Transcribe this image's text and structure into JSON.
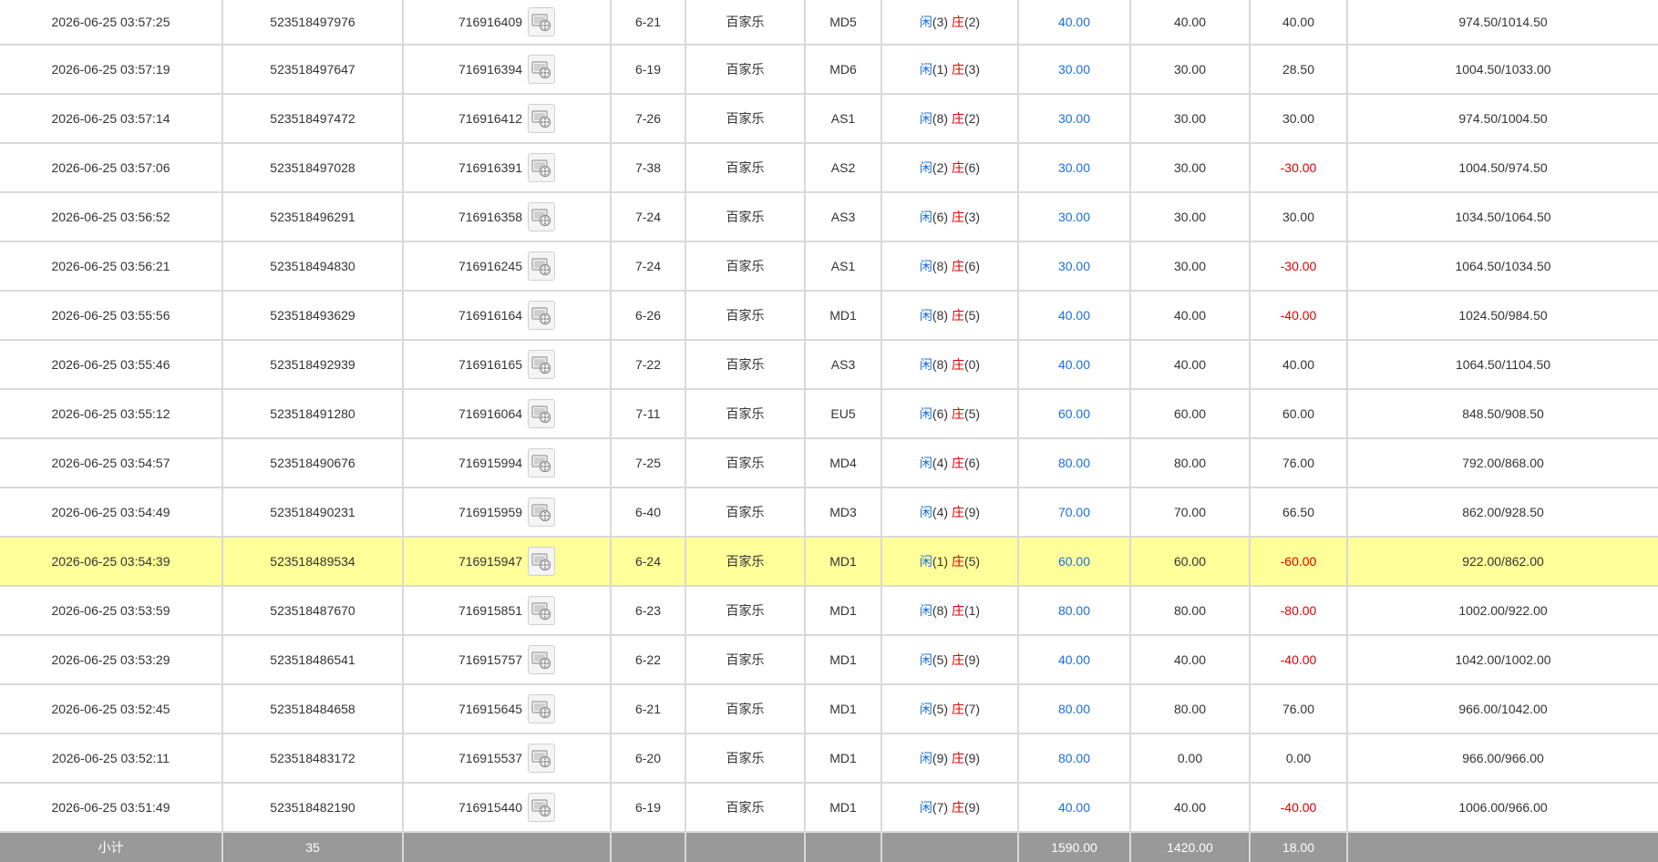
{
  "table": {
    "rows": [
      {
        "time": "2026-06-25 03:57:25",
        "bet_id": "523518497976",
        "round_id": "716916409",
        "shoe": "6-21",
        "game": "百家乐",
        "table": "MD5",
        "player_label": "闲",
        "player_score": "(3)",
        "banker_label": "庄",
        "banker_score": "(2)",
        "bet_amount": "40.00",
        "valid_bet": "40.00",
        "win_loss": "40.00",
        "win_loss_negative": false,
        "balance": "974.50/1014.50",
        "highlight": false
      },
      {
        "time": "2026-06-25 03:57:19",
        "bet_id": "523518497647",
        "round_id": "716916394",
        "shoe": "6-19",
        "game": "百家乐",
        "table": "MD6",
        "player_label": "闲",
        "player_score": "(1)",
        "banker_label": "庄",
        "banker_score": "(3)",
        "bet_amount": "30.00",
        "valid_bet": "30.00",
        "win_loss": "28.50",
        "win_loss_negative": false,
        "balance": "1004.50/1033.00",
        "highlight": false
      },
      {
        "time": "2026-06-25 03:57:14",
        "bet_id": "523518497472",
        "round_id": "716916412",
        "shoe": "7-26",
        "game": "百家乐",
        "table": "AS1",
        "player_label": "闲",
        "player_score": "(8)",
        "banker_label": "庄",
        "banker_score": "(2)",
        "bet_amount": "30.00",
        "valid_bet": "30.00",
        "win_loss": "30.00",
        "win_loss_negative": false,
        "balance": "974.50/1004.50",
        "highlight": false
      },
      {
        "time": "2026-06-25 03:57:06",
        "bet_id": "523518497028",
        "round_id": "716916391",
        "shoe": "7-38",
        "game": "百家乐",
        "table": "AS2",
        "player_label": "闲",
        "player_score": "(2)",
        "banker_label": "庄",
        "banker_score": "(6)",
        "bet_amount": "30.00",
        "valid_bet": "30.00",
        "win_loss": "-30.00",
        "win_loss_negative": true,
        "balance": "1004.50/974.50",
        "highlight": false
      },
      {
        "time": "2026-06-25 03:56:52",
        "bet_id": "523518496291",
        "round_id": "716916358",
        "shoe": "7-24",
        "game": "百家乐",
        "table": "AS3",
        "player_label": "闲",
        "player_score": "(6)",
        "banker_label": "庄",
        "banker_score": "(3)",
        "bet_amount": "30.00",
        "valid_bet": "30.00",
        "win_loss": "30.00",
        "win_loss_negative": false,
        "balance": "1034.50/1064.50",
        "highlight": false
      },
      {
        "time": "2026-06-25 03:56:21",
        "bet_id": "523518494830",
        "round_id": "716916245",
        "shoe": "7-24",
        "game": "百家乐",
        "table": "AS1",
        "player_label": "闲",
        "player_score": "(8)",
        "banker_label": "庄",
        "banker_score": "(6)",
        "bet_amount": "30.00",
        "valid_bet": "30.00",
        "win_loss": "-30.00",
        "win_loss_negative": true,
        "balance": "1064.50/1034.50",
        "highlight": false
      },
      {
        "time": "2026-06-25 03:55:56",
        "bet_id": "523518493629",
        "round_id": "716916164",
        "shoe": "6-26",
        "game": "百家乐",
        "table": "MD1",
        "player_label": "闲",
        "player_score": "(8)",
        "banker_label": "庄",
        "banker_score": "(5)",
        "bet_amount": "40.00",
        "valid_bet": "40.00",
        "win_loss": "-40.00",
        "win_loss_negative": true,
        "balance": "1024.50/984.50",
        "highlight": false
      },
      {
        "time": "2026-06-25 03:55:46",
        "bet_id": "523518492939",
        "round_id": "716916165",
        "shoe": "7-22",
        "game": "百家乐",
        "table": "AS3",
        "player_label": "闲",
        "player_score": "(8)",
        "banker_label": "庄",
        "banker_score": "(0)",
        "bet_amount": "40.00",
        "valid_bet": "40.00",
        "win_loss": "40.00",
        "win_loss_negative": false,
        "balance": "1064.50/1104.50",
        "highlight": false
      },
      {
        "time": "2026-06-25 03:55:12",
        "bet_id": "523518491280",
        "round_id": "716916064",
        "shoe": "7-11",
        "game": "百家乐",
        "table": "EU5",
        "player_label": "闲",
        "player_score": "(6)",
        "banker_label": "庄",
        "banker_score": "(5)",
        "bet_amount": "60.00",
        "valid_bet": "60.00",
        "win_loss": "60.00",
        "win_loss_negative": false,
        "balance": "848.50/908.50",
        "highlight": false
      },
      {
        "time": "2026-06-25 03:54:57",
        "bet_id": "523518490676",
        "round_id": "716915994",
        "shoe": "7-25",
        "game": "百家乐",
        "table": "MD4",
        "player_label": "闲",
        "player_score": "(4)",
        "banker_label": "庄",
        "banker_score": "(6)",
        "bet_amount": "80.00",
        "valid_bet": "80.00",
        "win_loss": "76.00",
        "win_loss_negative": false,
        "balance": "792.00/868.00",
        "highlight": false
      },
      {
        "time": "2026-06-25 03:54:49",
        "bet_id": "523518490231",
        "round_id": "716915959",
        "shoe": "6-40",
        "game": "百家乐",
        "table": "MD3",
        "player_label": "闲",
        "player_score": "(4)",
        "banker_label": "庄",
        "banker_score": "(9)",
        "bet_amount": "70.00",
        "valid_bet": "70.00",
        "win_loss": "66.50",
        "win_loss_negative": false,
        "balance": "862.00/928.50",
        "highlight": false
      },
      {
        "time": "2026-06-25 03:54:39",
        "bet_id": "523518489534",
        "round_id": "716915947",
        "shoe": "6-24",
        "game": "百家乐",
        "table": "MD1",
        "player_label": "闲",
        "player_score": "(1)",
        "banker_label": "庄",
        "banker_score": "(5)",
        "bet_amount": "60.00",
        "valid_bet": "60.00",
        "win_loss": "-60.00",
        "win_loss_negative": true,
        "balance": "922.00/862.00",
        "highlight": true
      },
      {
        "time": "2026-06-25 03:53:59",
        "bet_id": "523518487670",
        "round_id": "716915851",
        "shoe": "6-23",
        "game": "百家乐",
        "table": "MD1",
        "player_label": "闲",
        "player_score": "(8)",
        "banker_label": "庄",
        "banker_score": "(1)",
        "bet_amount": "80.00",
        "valid_bet": "80.00",
        "win_loss": "-80.00",
        "win_loss_negative": true,
        "balance": "1002.00/922.00",
        "highlight": false
      },
      {
        "time": "2026-06-25 03:53:29",
        "bet_id": "523518486541",
        "round_id": "716915757",
        "shoe": "6-22",
        "game": "百家乐",
        "table": "MD1",
        "player_label": "闲",
        "player_score": "(5)",
        "banker_label": "庄",
        "banker_score": "(9)",
        "bet_amount": "40.00",
        "valid_bet": "40.00",
        "win_loss": "-40.00",
        "win_loss_negative": true,
        "balance": "1042.00/1002.00",
        "highlight": false
      },
      {
        "time": "2026-06-25 03:52:45",
        "bet_id": "523518484658",
        "round_id": "716915645",
        "shoe": "6-21",
        "game": "百家乐",
        "table": "MD1",
        "player_label": "闲",
        "player_score": "(5)",
        "banker_label": "庄",
        "banker_score": "(7)",
        "bet_amount": "80.00",
        "valid_bet": "80.00",
        "win_loss": "76.00",
        "win_loss_negative": false,
        "balance": "966.00/1042.00",
        "highlight": false
      },
      {
        "time": "2026-06-25 03:52:11",
        "bet_id": "523518483172",
        "round_id": "716915537",
        "shoe": "6-20",
        "game": "百家乐",
        "table": "MD1",
        "player_label": "闲",
        "player_score": "(9)",
        "banker_label": "庄",
        "banker_score": "(9)",
        "bet_amount": "80.00",
        "valid_bet": "0.00",
        "win_loss": "0.00",
        "win_loss_negative": false,
        "balance": "966.00/966.00",
        "highlight": false
      },
      {
        "time": "2026-06-25 03:51:49",
        "bet_id": "523518482190",
        "round_id": "716915440",
        "shoe": "6-19",
        "game": "百家乐",
        "table": "MD1",
        "player_label": "闲",
        "player_score": "(7)",
        "banker_label": "庄",
        "banker_score": "(9)",
        "bet_amount": "40.00",
        "valid_bet": "40.00",
        "win_loss": "-40.00",
        "win_loss_negative": true,
        "balance": "1006.00/966.00",
        "highlight": false
      }
    ],
    "subtotal": {
      "label": "小计",
      "count": "35",
      "bet_amount": "1590.00",
      "valid_bet": "1420.00",
      "win_loss": "18.00"
    }
  },
  "icons": {
    "replay": "video-replay-icon"
  },
  "colors": {
    "player_blue": "#1a6fe0",
    "banker_red": "#e00000",
    "highlight_row": "#ffff99",
    "subtotal_bg": "#999999",
    "grid": "#d9d9d9"
  }
}
